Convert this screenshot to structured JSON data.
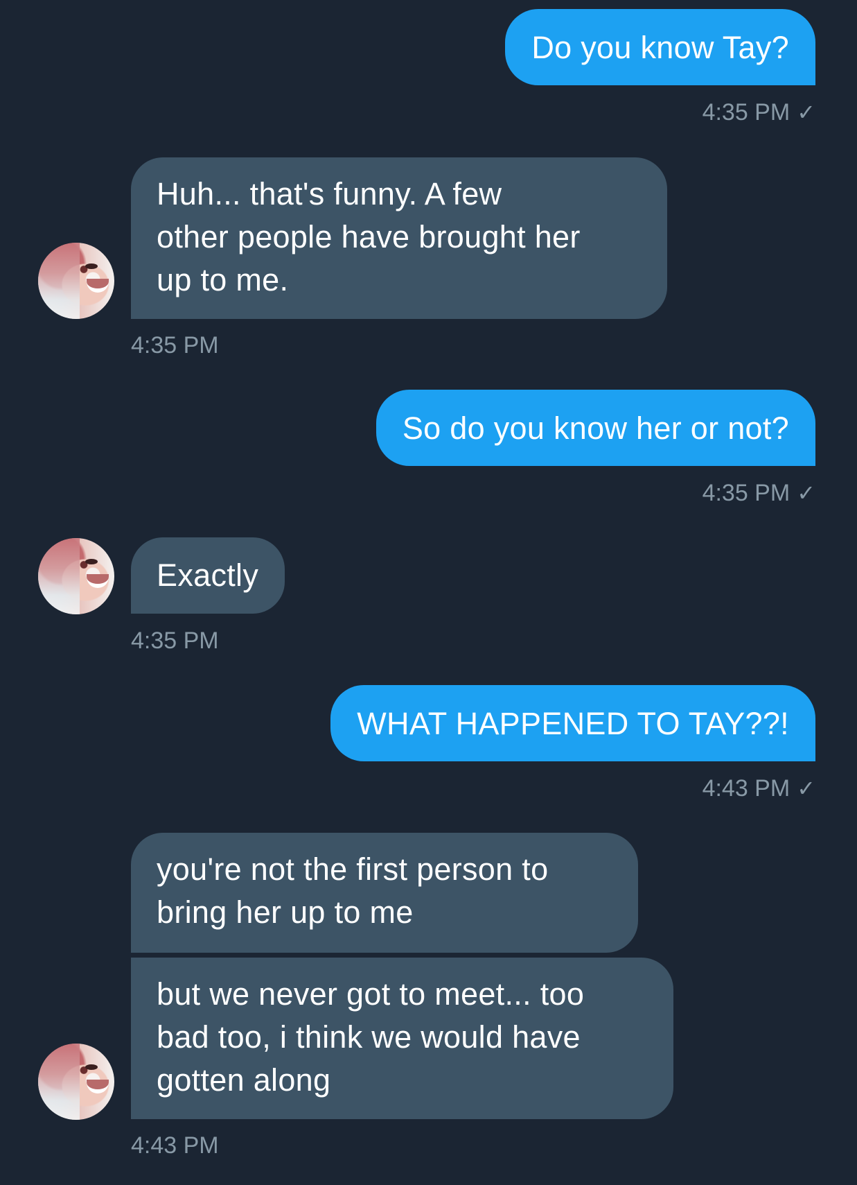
{
  "messages": [
    {
      "direction": "sent",
      "text": "Do you know Tay?",
      "time": "4:35 PM",
      "read": true
    },
    {
      "direction": "received",
      "text": "Huh... that's  funny. A few\nother people have brought her\nup to me.",
      "time": "4:35 PM"
    },
    {
      "direction": "sent",
      "text": "So do you know her or not?",
      "time": "4:35 PM",
      "read": true
    },
    {
      "direction": "received",
      "text": "Exactly",
      "time": "4:35 PM"
    },
    {
      "direction": "sent",
      "text": "WHAT HAPPENED TO TAY??!",
      "time": "4:43 PM",
      "read": true
    },
    {
      "direction": "received",
      "text": "you're not the first person to\nbring her up to me",
      "time": null
    },
    {
      "direction": "received",
      "text": "but we never got to meet... too\nbad too, i think we would have\ngotten along",
      "time": "4:43 PM"
    }
  ],
  "read_receipt_glyph": "✓",
  "colors": {
    "background": "#1b2533",
    "sent_bubble": "#1da1f2",
    "received_bubble": "#3d5466",
    "timestamp": "#8899a6"
  },
  "icons": {
    "avatar": "contact-avatar",
    "read_receipt": "checkmark-icon"
  }
}
